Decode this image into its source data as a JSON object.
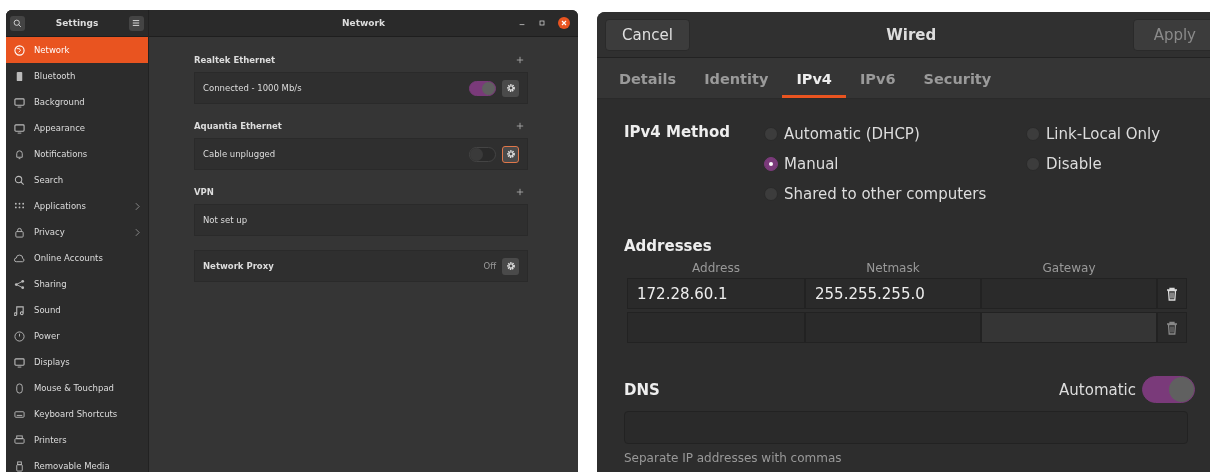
{
  "settings_window": {
    "sidebar_title": "Settings",
    "title": "Network",
    "sidebar": {
      "items": [
        {
          "label": "Network",
          "selected": true,
          "submenu": false
        },
        {
          "label": "Bluetooth",
          "selected": false,
          "submenu": false
        },
        {
          "label": "Background",
          "selected": false,
          "submenu": false
        },
        {
          "label": "Appearance",
          "selected": false,
          "submenu": false
        },
        {
          "label": "Notifications",
          "selected": false,
          "submenu": false
        },
        {
          "label": "Search",
          "selected": false,
          "submenu": false
        },
        {
          "label": "Applications",
          "selected": false,
          "submenu": true
        },
        {
          "label": "Privacy",
          "selected": false,
          "submenu": true
        },
        {
          "label": "Online Accounts",
          "selected": false,
          "submenu": false
        },
        {
          "label": "Sharing",
          "selected": false,
          "submenu": false
        },
        {
          "label": "Sound",
          "selected": false,
          "submenu": false
        },
        {
          "label": "Power",
          "selected": false,
          "submenu": false
        },
        {
          "label": "Displays",
          "selected": false,
          "submenu": false
        },
        {
          "label": "Mouse & Touchpad",
          "selected": false,
          "submenu": false
        },
        {
          "label": "Keyboard Shortcuts",
          "selected": false,
          "submenu": false
        },
        {
          "label": "Printers",
          "selected": false,
          "submenu": false
        },
        {
          "label": "Removable Media",
          "selected": false,
          "submenu": false
        }
      ]
    },
    "sections": [
      {
        "title": "Realtek Ethernet",
        "kind": "device",
        "status": "Connected - 1000 Mb/s",
        "on": true,
        "focused": false,
        "add": true
      },
      {
        "title": "Aquantia Ethernet",
        "kind": "device",
        "status": "Cable unplugged",
        "on": false,
        "focused": true,
        "add": true
      },
      {
        "title": "VPN",
        "kind": "empty",
        "status": "Not set up",
        "add": true
      },
      {
        "kind": "proxy",
        "label": "Network Proxy",
        "value": "Off"
      }
    ]
  },
  "wired_dialog": {
    "title": "Wired",
    "cancel": "Cancel",
    "apply": "Apply",
    "tabs": [
      {
        "label": "Details",
        "selected": false
      },
      {
        "label": "Identity",
        "selected": false
      },
      {
        "label": "IPv4",
        "selected": true
      },
      {
        "label": "IPv6",
        "selected": false
      },
      {
        "label": "Security",
        "selected": false
      }
    ],
    "method_label": "IPv4 Method",
    "methods": [
      [
        {
          "label": "Automatic (DHCP)",
          "selected": false
        },
        {
          "label": "Manual",
          "selected": true
        },
        {
          "label": "Shared to other computers",
          "selected": false
        }
      ],
      [
        {
          "label": "Link-Local Only",
          "selected": false
        },
        {
          "label": "Disable",
          "selected": false
        }
      ]
    ],
    "addresses_label": "Addresses",
    "columns": [
      "Address",
      "Netmask",
      "Gateway"
    ],
    "rows": [
      [
        "172.28.60.1",
        "255.255.255.0",
        null
      ],
      [
        null,
        null,
        null
      ]
    ],
    "dns_label": "DNS",
    "dns_auto_label": "Automatic",
    "dns_auto": true,
    "dns_hint": "Separate IP addresses with commas"
  }
}
